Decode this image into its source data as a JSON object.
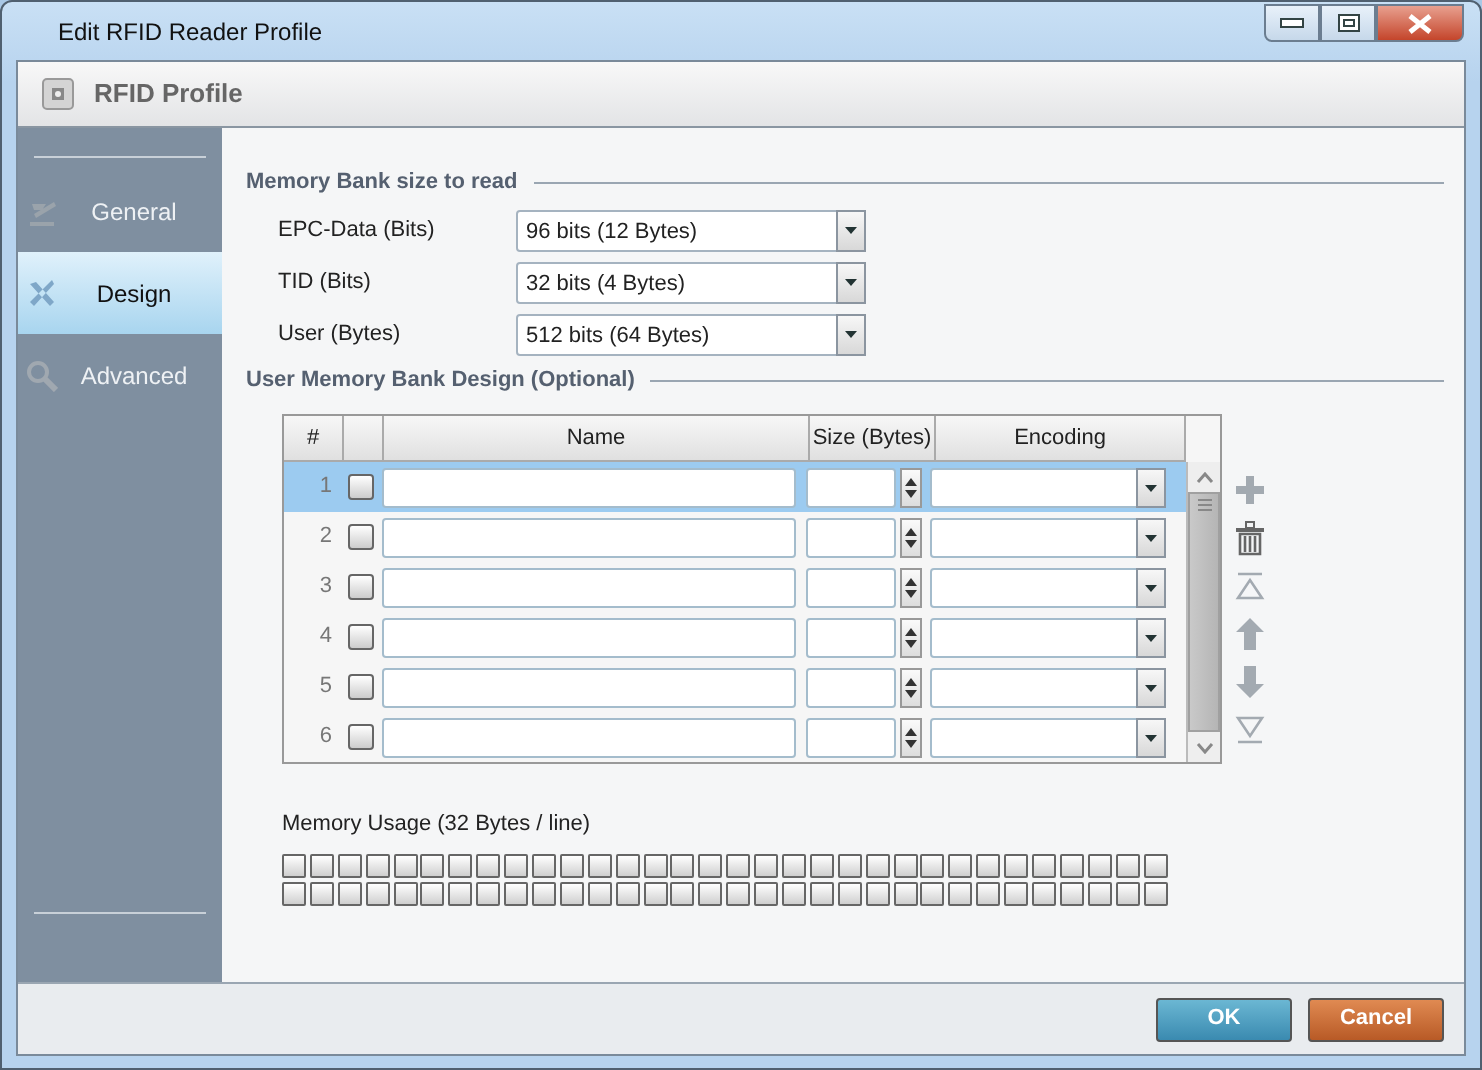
{
  "window": {
    "title": "Edit RFID Reader Profile"
  },
  "header": {
    "title": "RFID Profile"
  },
  "sidebar": {
    "items": [
      {
        "label": "General",
        "kind": "general",
        "selected": false
      },
      {
        "label": "Design",
        "kind": "design",
        "selected": true
      },
      {
        "label": "Advanced",
        "kind": "advanced",
        "selected": false
      }
    ]
  },
  "memory_bank": {
    "title": "Memory Bank size to read",
    "fields": [
      {
        "label": "EPC-Data (Bits)",
        "value": "96 bits (12 Bytes)"
      },
      {
        "label": "TID (Bits)",
        "value": "32 bits (4 Bytes)"
      },
      {
        "label": "User (Bytes)",
        "value": "512 bits (64 Bytes)"
      }
    ]
  },
  "design": {
    "title": "User Memory Bank Design (Optional)",
    "table": {
      "columns": [
        "#",
        "Name",
        "Size (Bytes)",
        "Encoding"
      ],
      "rows": [
        {
          "number": "1",
          "checked": false,
          "selected": true
        },
        {
          "number": "2",
          "checked": false,
          "selected": false
        },
        {
          "number": "3",
          "checked": false,
          "selected": false
        },
        {
          "number": "4",
          "checked": false,
          "selected": false
        },
        {
          "number": "5",
          "checked": false,
          "selected": false
        },
        {
          "number": "6",
          "checked": false,
          "selected": false
        }
      ]
    }
  },
  "memory_usage": {
    "label": "Memory Usage (32 Bytes / line)"
  },
  "buttons": [
    {
      "label": "OK",
      "kind": "ok"
    },
    {
      "label": "Cancel",
      "kind": "cancel"
    }
  ]
}
